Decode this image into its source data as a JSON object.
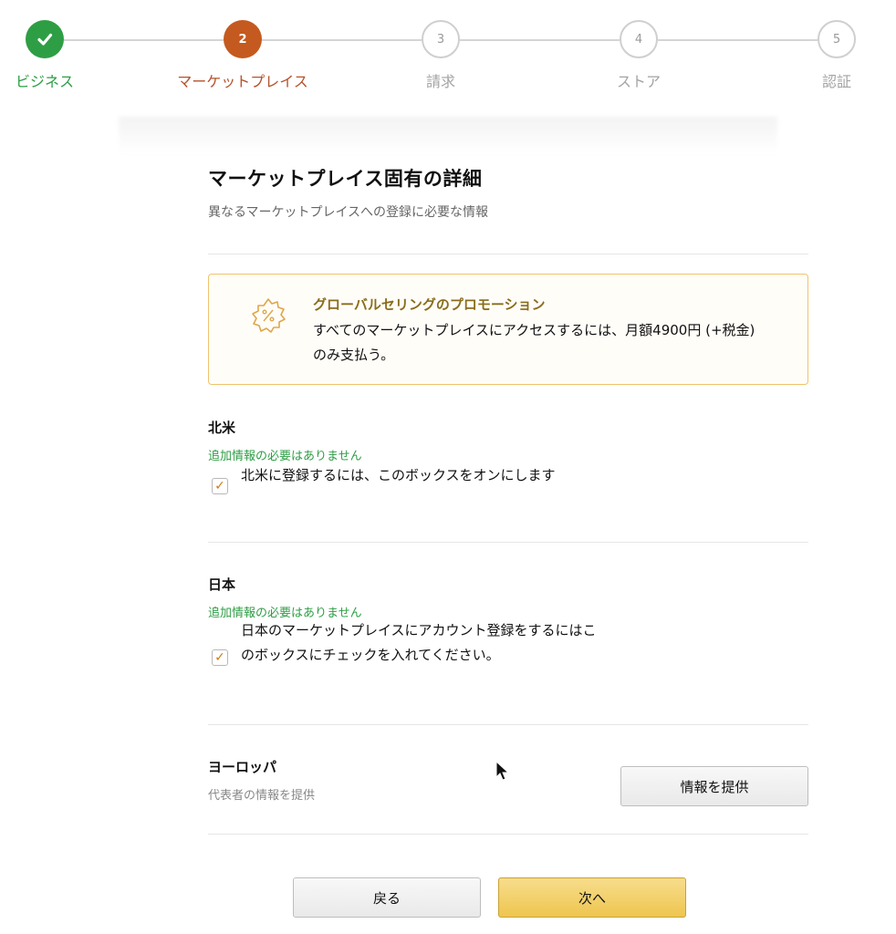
{
  "stepper": {
    "steps": [
      {
        "number": "",
        "label": "ビジネス",
        "state": "done"
      },
      {
        "number": "2",
        "label": "マーケットプレイス",
        "state": "active"
      },
      {
        "number": "3",
        "label": "請求",
        "state": "todo"
      },
      {
        "number": "4",
        "label": "ストア",
        "state": "todo"
      },
      {
        "number": "5",
        "label": "認証",
        "state": "todo"
      }
    ]
  },
  "page": {
    "title": "マーケットプレイス固有の詳細",
    "subtitle": "異なるマーケットプレイスへの登録に必要な情報"
  },
  "promo": {
    "icon": "badge-percent-icon",
    "title": "グローバルセリングのプロモーション",
    "text": "すべてのマーケットプレイスにアクセスするには、月額4900円 (+税金) のみ支払う。"
  },
  "regions": {
    "north_america": {
      "name": "北米",
      "status": "追加情報の必要はありません",
      "checkbox_label": "北米に登録するには、このボックスをオンにします",
      "checked": true
    },
    "japan": {
      "name": "日本",
      "status": "追加情報の必要はありません",
      "checkbox_label": "日本のマーケットプレイスにアカウント登録をするにはこのボックスにチェックを入れてください。",
      "checked": true
    },
    "europe": {
      "name": "ヨーロッパ",
      "note": "代表者の情報を提供",
      "button_label": "情報を提供"
    }
  },
  "footer": {
    "back_label": "戻る",
    "next_label": "次へ"
  },
  "colors": {
    "done": "#2e9e45",
    "active": "#c45a1f",
    "primary_button": "#eec54f",
    "promo_border": "#f0c36d"
  }
}
